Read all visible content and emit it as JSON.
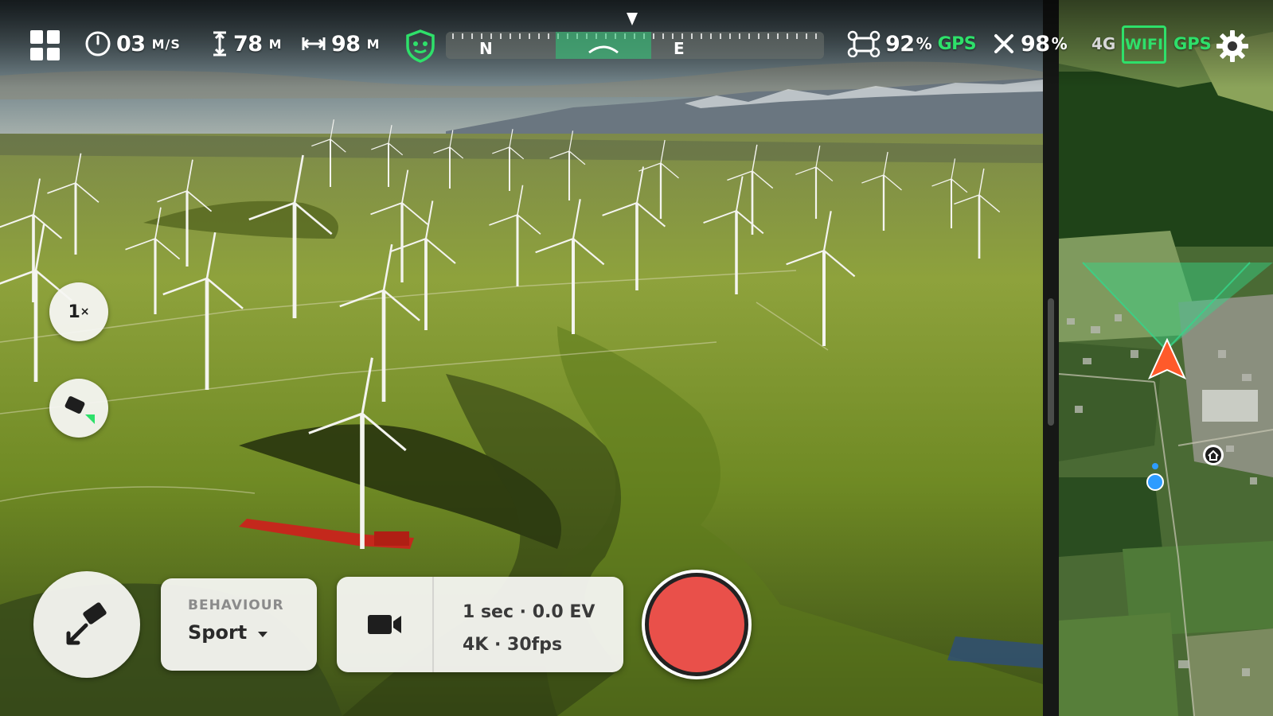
{
  "telemetry": {
    "speed": {
      "value": "03",
      "unit": "M/S",
      "icon": "speedometer-icon"
    },
    "altitude": {
      "value": "78",
      "unit": "M",
      "icon": "altitude-icon"
    },
    "distance": {
      "value": "98",
      "unit": "M",
      "icon": "distance-icon"
    },
    "shield_icon": "shield-icon"
  },
  "compass": {
    "left_heading": "N",
    "right_heading": "E"
  },
  "status": {
    "drone_battery": "92",
    "drone_battery_unit": "%",
    "drone_gps": "GPS",
    "controller_battery": "98",
    "controller_battery_unit": "%",
    "network": "4G",
    "wifi": "WIFI",
    "controller_gps": "GPS"
  },
  "controls": {
    "zoom_value": "1",
    "zoom_suffix": "×",
    "behaviour_label": "BEHAVIOUR",
    "behaviour_value": "Sport",
    "camera_line1": "1 sec · 0.0 EV",
    "camera_line2": "4K · 30fps"
  },
  "colors": {
    "accent_green": "#2ee06a",
    "record_red": "#e9504a",
    "card_bg": "#f5f5f2"
  }
}
